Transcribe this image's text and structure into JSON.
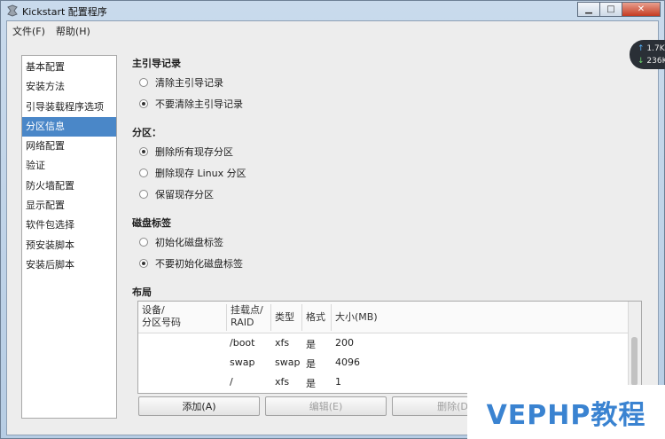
{
  "window": {
    "title": "Kickstart 配置程序"
  },
  "menu": [
    "文件(F)",
    "帮助(H)"
  ],
  "sidebar": {
    "items": [
      {
        "label": "基本配置"
      },
      {
        "label": "安装方法"
      },
      {
        "label": "引导装载程序选项"
      },
      {
        "label": "分区信息",
        "selected": true
      },
      {
        "label": "网络配置"
      },
      {
        "label": "验证"
      },
      {
        "label": "防火墙配置"
      },
      {
        "label": "显示配置"
      },
      {
        "label": "软件包选择"
      },
      {
        "label": "预安装脚本"
      },
      {
        "label": "安装后脚本"
      }
    ]
  },
  "mbr": {
    "title": "主引导记录",
    "options": [
      {
        "label": "清除主引导记录",
        "checked": false
      },
      {
        "label": "不要清除主引导记录",
        "checked": true
      }
    ]
  },
  "partition": {
    "title": "分区：",
    "options": [
      {
        "label": "删除所有现存分区",
        "checked": true
      },
      {
        "label": "删除现存 Linux 分区",
        "checked": false
      },
      {
        "label": "保留现存分区",
        "checked": false
      }
    ]
  },
  "disklabel": {
    "title": "磁盘标签",
    "options": [
      {
        "label": "初始化磁盘标签",
        "checked": false
      },
      {
        "label": "不要初始化磁盘标签",
        "checked": true
      }
    ]
  },
  "layout": {
    "title": "布局",
    "columns": [
      "设备/\n分区号码",
      "挂载点/\nRAID",
      "类型",
      "格式",
      "大小(MB)"
    ],
    "rows": [
      [
        "",
        "/boot",
        "xfs",
        "是",
        "200"
      ],
      [
        "",
        "swap",
        "swap",
        "是",
        "4096"
      ],
      [
        "",
        "/",
        "xfs",
        "是",
        "1"
      ]
    ]
  },
  "buttons": {
    "add": "添加(A)",
    "edit": "编辑(E)",
    "delete": "删除(D"
  },
  "net_widget": {
    "up": "1.7K",
    "down": "236K"
  },
  "watermark": "VEPHP教程"
}
